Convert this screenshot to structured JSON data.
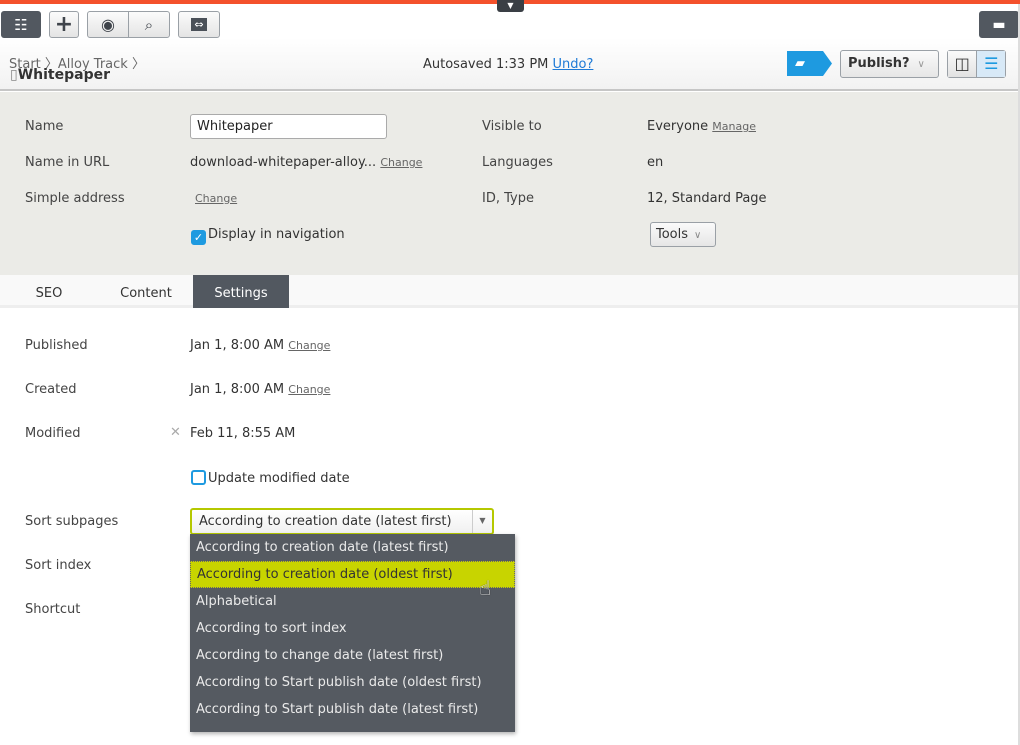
{
  "toolbar": {
    "icons": [
      "page-tree-icon",
      "add-icon",
      "preview-eye-icon",
      "view-settings-icon",
      "compare-icon",
      "assets-folder-icon"
    ]
  },
  "breadcrumb": {
    "items": [
      "Start",
      "Alloy Track"
    ],
    "current": "Whitepaper"
  },
  "status": {
    "autosaved": "Autosaved 1:33 PM",
    "undo": "Undo?"
  },
  "actions": {
    "publish": "Publish?"
  },
  "properties": {
    "name_label": "Name",
    "name_value": "Whitepaper",
    "url_label": "Name in URL",
    "url_value": "download-whitepaper-alloy...",
    "url_change": "Change",
    "simple_label": "Simple address",
    "simple_change": "Change",
    "nav_label": "Display in navigation",
    "nav_checked": true,
    "visible_label": "Visible to",
    "visible_value": "Everyone",
    "visible_manage": "Manage",
    "lang_label": "Languages",
    "lang_value": "en",
    "id_label": "ID, Type",
    "id_value": "12, Standard Page",
    "tools": "Tools"
  },
  "tabs": [
    {
      "label": "SEO"
    },
    {
      "label": "Content"
    },
    {
      "label": "Settings",
      "active": true
    }
  ],
  "settings": {
    "published_label": "Published",
    "published_value": "Jan 1, 8:00 AM",
    "published_change": "Change",
    "created_label": "Created",
    "created_value": "Jan 1, 8:00 AM",
    "created_change": "Change",
    "modified_label": "Modified",
    "modified_value": "Feb 11, 8:55 AM",
    "update_modified": "Update modified date",
    "update_checked": false,
    "sort_label": "Sort subpages",
    "sort_selected": "According to creation date (latest first)",
    "sortindex_label": "Sort index",
    "shortcut_label": "Shortcut",
    "options": [
      "According to creation date (latest first)",
      "According to creation date (oldest first)",
      "Alphabetical",
      "According to sort index",
      "According to change date (latest first)",
      "According to Start publish date (oldest first)",
      "According to Start publish date (latest first)"
    ],
    "highlighted_index": 1
  },
  "colors": {
    "accent": "#f4512c",
    "highlight": "#c8d400",
    "dropdown_bg": "#555a61",
    "link": "#1e7ad6",
    "info": "#1e9ae0"
  }
}
